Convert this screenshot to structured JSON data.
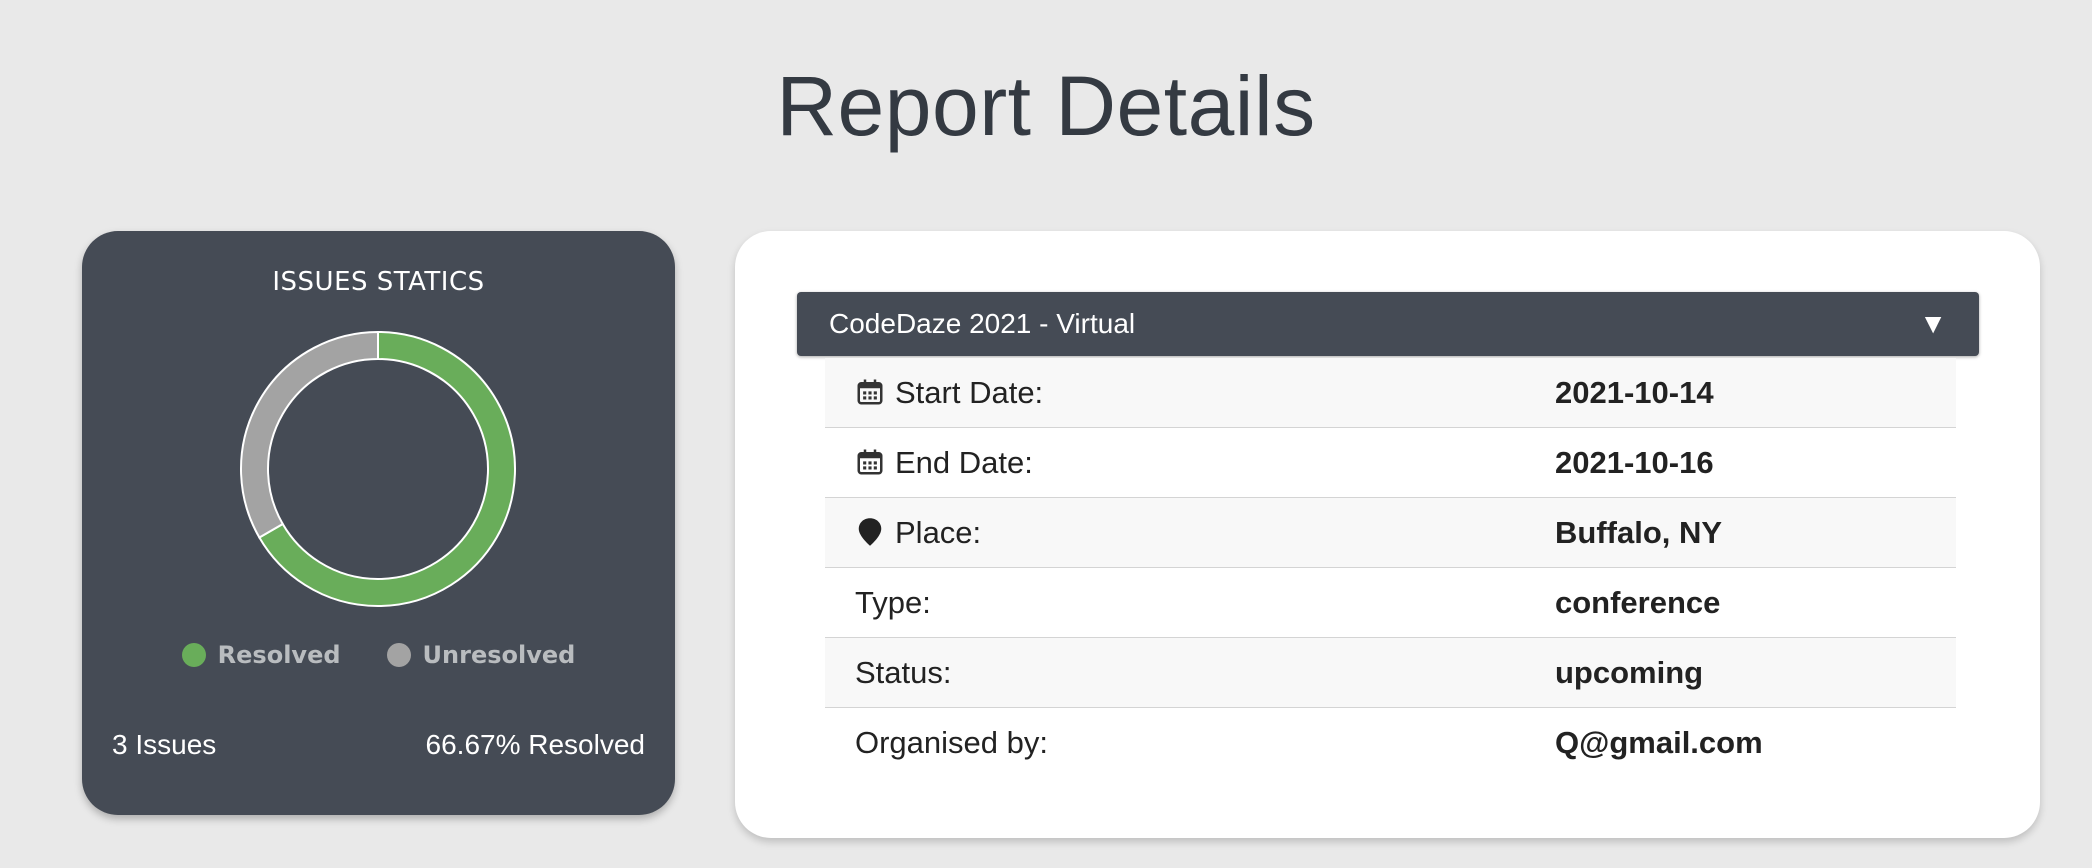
{
  "page": {
    "title": "Report Details"
  },
  "stats": {
    "title": "ISSUES STATICS",
    "legend": [
      {
        "label": "Resolved",
        "color": "#69ad5a"
      },
      {
        "label": "Unresolved",
        "color": "#a3a3a3"
      }
    ],
    "issues_count": "3 Issues",
    "resolved_text": "66.67% Resolved",
    "icons": {
      "legend_marker": "circle"
    }
  },
  "chart_data": {
    "type": "pie",
    "donut": true,
    "series": [
      {
        "name": "Resolved",
        "value": 2,
        "color": "#69ad5a"
      },
      {
        "name": "Unresolved",
        "value": 1,
        "color": "#a3a3a3"
      }
    ],
    "legend_position": "bottom"
  },
  "details": {
    "selected_event": "CodeDaze 2021 - Virtual",
    "select_arrow": "▼",
    "rows": [
      {
        "label": "Start Date:",
        "value": "2021-10-14",
        "icon": "calendar-icon"
      },
      {
        "label": "End Date:",
        "value": "2021-10-16",
        "icon": "calendar-icon"
      },
      {
        "label": "Place:",
        "value": "Buffalo, NY",
        "icon": "map-pin-icon"
      },
      {
        "label": "Type:",
        "value": "conference"
      },
      {
        "label": "Status:",
        "value": "upcoming"
      },
      {
        "label": "Organised by:",
        "value": "Q@gmail.com"
      }
    ]
  }
}
